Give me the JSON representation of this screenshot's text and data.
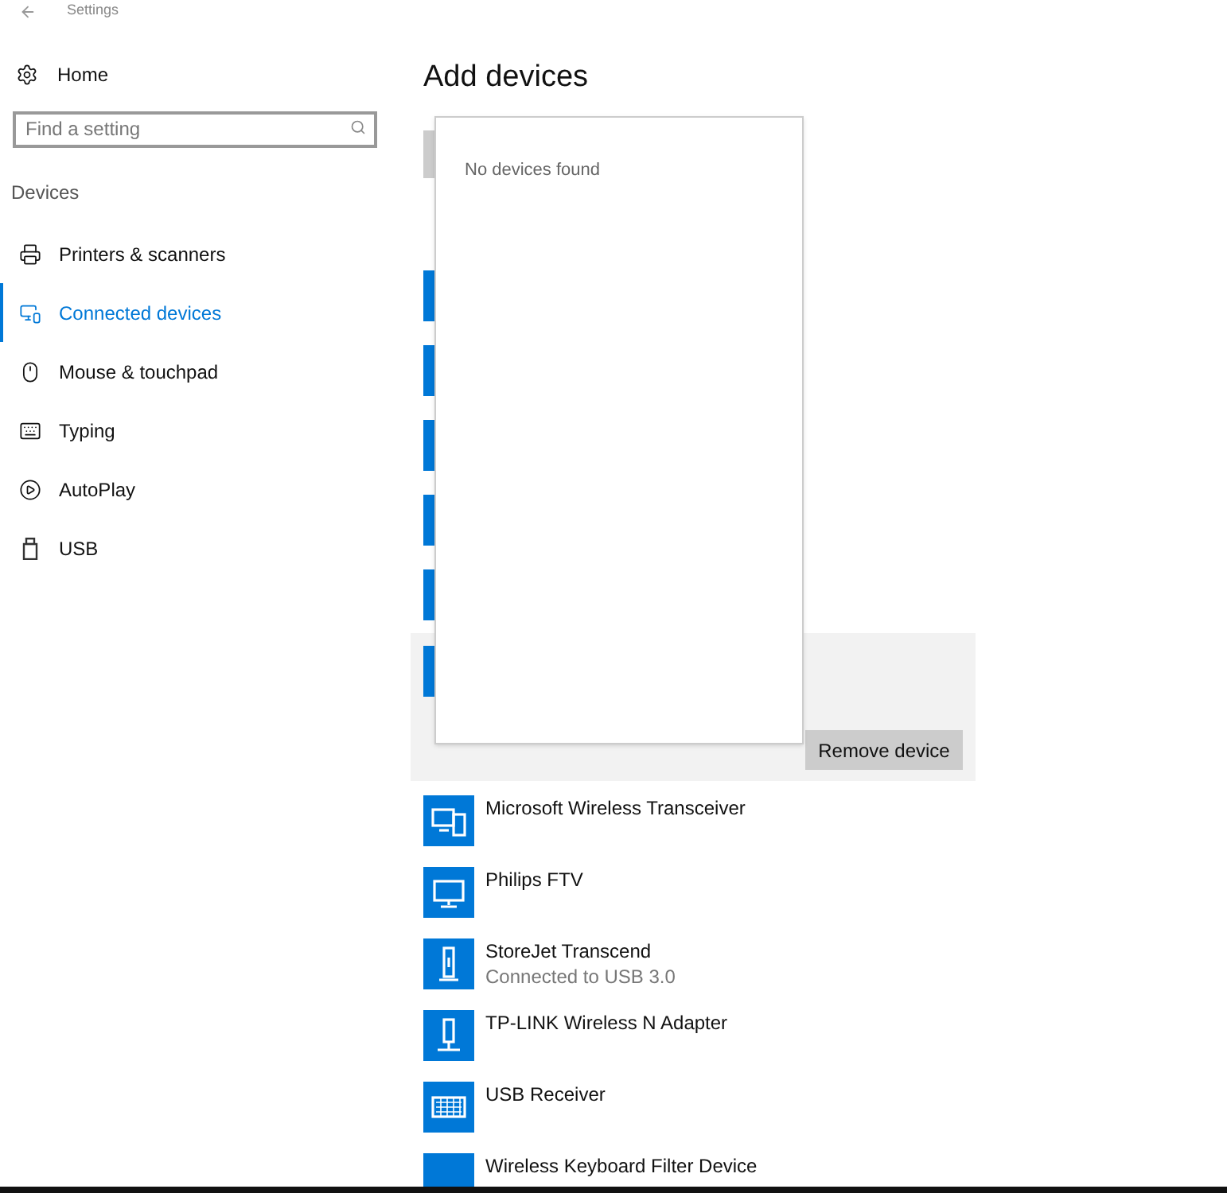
{
  "window": {
    "title": "Settings"
  },
  "sidebar": {
    "home": "Home",
    "search": {
      "placeholder": "Find a setting"
    },
    "section": "Devices",
    "items": [
      {
        "label": "Printers & scanners",
        "selected": false
      },
      {
        "label": "Connected devices",
        "selected": true
      },
      {
        "label": "Mouse & touchpad",
        "selected": false
      },
      {
        "label": "Typing",
        "selected": false
      },
      {
        "label": "AutoPlay",
        "selected": false
      },
      {
        "label": "USB",
        "selected": false
      }
    ]
  },
  "main": {
    "title": "Add devices",
    "hidden_devices": [
      {
        "selected": false
      },
      {
        "selected": false
      },
      {
        "selected": false
      },
      {
        "selected": false
      },
      {
        "selected": false
      },
      {
        "selected": true
      }
    ],
    "remove_button": "Remove device",
    "devices": [
      {
        "name": "Microsoft Wireless Transceiver"
      },
      {
        "name": "Philips FTV"
      },
      {
        "name": "StoreJet Transcend",
        "status": "Connected to USB 3.0"
      },
      {
        "name": "TP-LINK Wireless N Adapter"
      },
      {
        "name": "USB Receiver"
      },
      {
        "name": "Wireless Keyboard Filter Device"
      }
    ],
    "popup": {
      "message": "No devices found"
    }
  }
}
